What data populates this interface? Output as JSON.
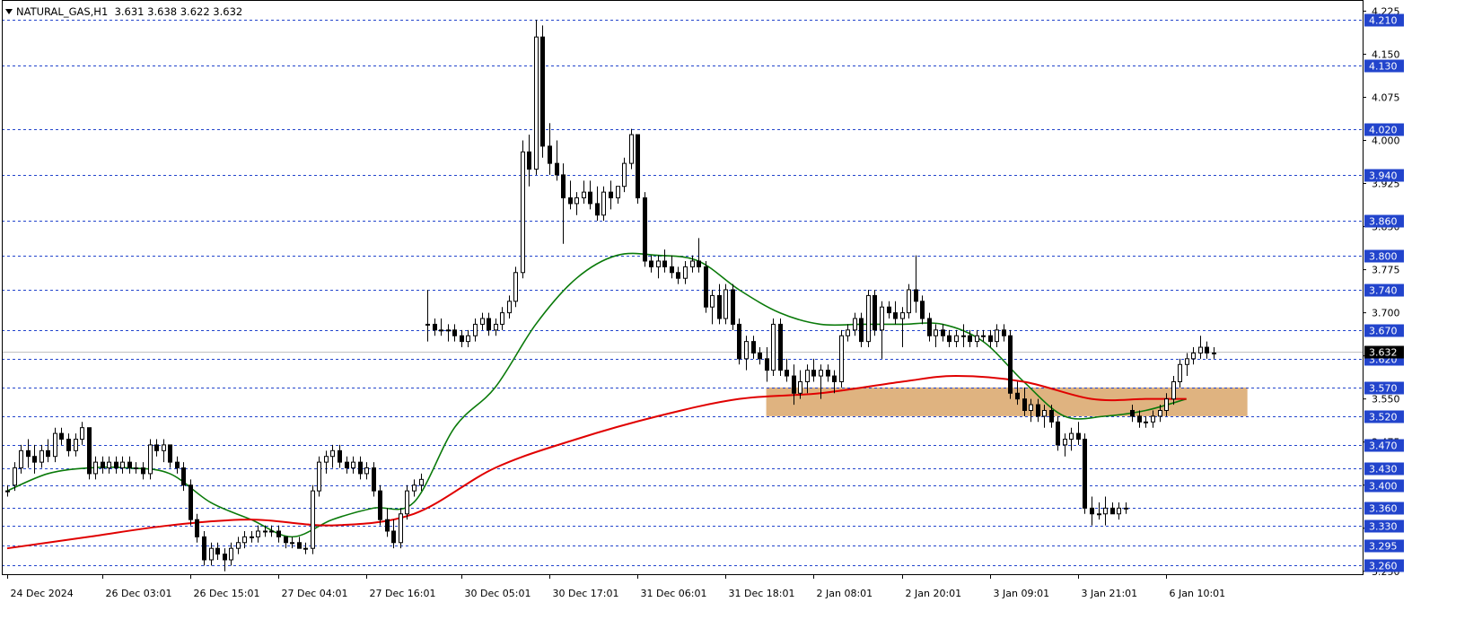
{
  "header": {
    "symbol": "NATURAL_GAS,H1",
    "ohlc": "3.631 3.638 3.622 3.632"
  },
  "colors": {
    "background": "#ffffff",
    "candle_outline": "#000000",
    "bull_fill": "#ffffff",
    "bear_fill": "#000000",
    "ma_fast": "#0a7a0a",
    "ma_slow": "#e00000",
    "level_line": "#2244cc",
    "level_label_bg": "#2244cc",
    "zone_fill": "#d9a66a",
    "price_line": "#c0c0c0",
    "current_label_bg": "#000000"
  },
  "chart_data": {
    "type": "candlestick",
    "title": "NATURAL_GAS,H1",
    "ylim": [
      3.245,
      4.235
    ],
    "y_ticks": [
      "4.225",
      "4.150",
      "4.075",
      "4.000",
      "3.925",
      "3.850",
      "3.775",
      "3.700",
      "3.625",
      "3.550",
      "3.475",
      "3.400",
      "3.325",
      "3.250"
    ],
    "x_ticks": [
      {
        "index": 0,
        "label": "24 Dec 2024"
      },
      {
        "index": 14,
        "label": "26 Dec 03:01"
      },
      {
        "index": 27,
        "label": "26 Dec 15:01"
      },
      {
        "index": 40,
        "label": "27 Dec 04:01"
      },
      {
        "index": 53,
        "label": "27 Dec 16:01"
      },
      {
        "index": 67,
        "label": "30 Dec 05:01"
      },
      {
        "index": 80,
        "label": "30 Dec 17:01"
      },
      {
        "index": 93,
        "label": "31 Dec 06:01"
      },
      {
        "index": 106,
        "label": "31 Dec 18:01"
      },
      {
        "index": 119,
        "label": "2 Jan 08:01"
      },
      {
        "index": 132,
        "label": "2 Jan 20:01"
      },
      {
        "index": 145,
        "label": "3 Jan 09:01"
      },
      {
        "index": 158,
        "label": "3 Jan 21:01"
      },
      {
        "index": 171,
        "label": "6 Jan 10:01"
      }
    ],
    "horizontal_levels": [
      "4.210",
      "4.130",
      "4.020",
      "3.940",
      "3.860",
      "3.800",
      "3.740",
      "3.670",
      "3.620",
      "3.570",
      "3.520",
      "3.470",
      "3.430",
      "3.400",
      "3.360",
      "3.330",
      "3.295",
      "3.260"
    ],
    "current_price": "3.632",
    "zone": {
      "start_index": 112,
      "end_index": 183,
      "low": 3.52,
      "high": 3.57
    },
    "candles": [
      [
        3.39,
        3.4,
        3.38,
        3.39
      ],
      [
        3.4,
        3.44,
        3.39,
        3.43
      ],
      [
        3.43,
        3.47,
        3.42,
        3.46
      ],
      [
        3.46,
        3.48,
        3.43,
        3.45
      ],
      [
        3.45,
        3.47,
        3.42,
        3.44
      ],
      [
        3.44,
        3.47,
        3.43,
        3.46
      ],
      [
        3.46,
        3.48,
        3.44,
        3.45
      ],
      [
        3.45,
        3.5,
        3.44,
        3.49
      ],
      [
        3.49,
        3.5,
        3.47,
        3.48
      ],
      [
        3.48,
        3.49,
        3.45,
        3.46
      ],
      [
        3.46,
        3.49,
        3.45,
        3.48
      ],
      [
        3.48,
        3.51,
        3.47,
        3.5
      ],
      [
        3.5,
        3.5,
        3.41,
        3.42
      ],
      [
        3.42,
        3.45,
        3.41,
        3.44
      ],
      [
        3.44,
        3.45,
        3.42,
        3.43
      ],
      [
        3.43,
        3.45,
        3.42,
        3.44
      ],
      [
        3.44,
        3.45,
        3.42,
        3.43
      ],
      [
        3.43,
        3.45,
        3.42,
        3.44
      ],
      [
        3.44,
        3.45,
        3.42,
        3.43
      ],
      [
        3.43,
        3.44,
        3.42,
        3.43
      ],
      [
        3.43,
        3.44,
        3.41,
        3.42
      ],
      [
        3.42,
        3.48,
        3.41,
        3.47
      ],
      [
        3.47,
        3.48,
        3.45,
        3.46
      ],
      [
        3.46,
        3.48,
        3.44,
        3.47
      ],
      [
        3.47,
        3.47,
        3.43,
        3.44
      ],
      [
        3.44,
        3.45,
        3.42,
        3.43
      ],
      [
        3.43,
        3.44,
        3.39,
        3.4
      ],
      [
        3.4,
        3.41,
        3.33,
        3.34
      ],
      [
        3.34,
        3.35,
        3.3,
        3.31
      ],
      [
        3.31,
        3.32,
        3.26,
        3.27
      ],
      [
        3.27,
        3.3,
        3.26,
        3.29
      ],
      [
        3.29,
        3.3,
        3.27,
        3.28
      ],
      [
        3.28,
        3.29,
        3.25,
        3.27
      ],
      [
        3.27,
        3.3,
        3.26,
        3.29
      ],
      [
        3.29,
        3.31,
        3.28,
        3.3
      ],
      [
        3.3,
        3.32,
        3.29,
        3.31
      ],
      [
        3.31,
        3.32,
        3.3,
        3.31
      ],
      [
        3.31,
        3.33,
        3.3,
        3.32
      ],
      [
        3.32,
        3.33,
        3.31,
        3.32
      ],
      [
        3.32,
        3.33,
        3.31,
        3.32
      ],
      [
        3.32,
        3.33,
        3.3,
        3.31
      ],
      [
        3.31,
        3.31,
        3.29,
        3.3
      ],
      [
        3.3,
        3.31,
        3.29,
        3.3
      ],
      [
        3.3,
        3.31,
        3.29,
        3.29
      ],
      [
        3.29,
        3.3,
        3.28,
        3.29
      ],
      [
        3.29,
        3.4,
        3.28,
        3.39
      ],
      [
        3.39,
        3.45,
        3.38,
        3.44
      ],
      [
        3.44,
        3.46,
        3.42,
        3.45
      ],
      [
        3.45,
        3.47,
        3.43,
        3.46
      ],
      [
        3.46,
        3.47,
        3.43,
        3.44
      ],
      [
        3.44,
        3.45,
        3.42,
        3.43
      ],
      [
        3.43,
        3.45,
        3.42,
        3.44
      ],
      [
        3.44,
        3.45,
        3.41,
        3.42
      ],
      [
        3.42,
        3.44,
        3.41,
        3.43
      ],
      [
        3.43,
        3.44,
        3.38,
        3.39
      ],
      [
        3.39,
        3.4,
        3.33,
        3.34
      ],
      [
        3.34,
        3.36,
        3.31,
        3.32
      ],
      [
        3.32,
        3.34,
        3.29,
        3.3
      ],
      [
        3.3,
        3.36,
        3.29,
        3.35
      ],
      [
        3.35,
        3.4,
        3.34,
        3.39
      ],
      [
        3.39,
        3.41,
        3.38,
        3.4
      ],
      [
        3.4,
        3.42,
        3.39,
        3.41
      ],
      [
        3.68,
        3.74,
        3.65,
        3.68
      ],
      [
        3.68,
        3.69,
        3.66,
        3.67
      ],
      [
        3.67,
        3.69,
        3.66,
        3.67
      ],
      [
        3.67,
        3.68,
        3.65,
        3.67
      ],
      [
        3.67,
        3.68,
        3.65,
        3.66
      ],
      [
        3.66,
        3.67,
        3.64,
        3.65
      ],
      [
        3.65,
        3.67,
        3.64,
        3.66
      ],
      [
        3.66,
        3.69,
        3.65,
        3.68
      ],
      [
        3.68,
        3.7,
        3.67,
        3.69
      ],
      [
        3.69,
        3.7,
        3.66,
        3.67
      ],
      [
        3.67,
        3.69,
        3.66,
        3.68
      ],
      [
        3.68,
        3.71,
        3.67,
        3.7
      ],
      [
        3.7,
        3.73,
        3.69,
        3.72
      ],
      [
        3.72,
        3.78,
        3.71,
        3.77
      ],
      [
        3.77,
        4.0,
        3.76,
        3.98
      ],
      [
        3.98,
        4.01,
        3.92,
        3.95
      ],
      [
        3.95,
        4.21,
        3.94,
        4.18
      ],
      [
        4.18,
        4.2,
        3.97,
        3.99
      ],
      [
        3.99,
        4.03,
        3.94,
        3.96
      ],
      [
        3.96,
        4.0,
        3.93,
        3.94
      ],
      [
        3.94,
        3.96,
        3.82,
        3.9
      ],
      [
        3.9,
        3.93,
        3.88,
        3.89
      ],
      [
        3.89,
        3.91,
        3.87,
        3.9
      ],
      [
        3.9,
        3.93,
        3.89,
        3.91
      ],
      [
        3.91,
        3.93,
        3.88,
        3.89
      ],
      [
        3.89,
        3.92,
        3.86,
        3.87
      ],
      [
        3.87,
        3.92,
        3.86,
        3.91
      ],
      [
        3.91,
        3.93,
        3.88,
        3.9
      ],
      [
        3.9,
        3.92,
        3.89,
        3.92
      ],
      [
        3.92,
        3.97,
        3.91,
        3.96
      ],
      [
        3.96,
        4.02,
        3.95,
        4.01
      ],
      [
        4.01,
        4.01,
        3.89,
        3.9
      ],
      [
        3.9,
        3.91,
        3.78,
        3.79
      ],
      [
        3.79,
        3.8,
        3.77,
        3.78
      ],
      [
        3.78,
        3.8,
        3.76,
        3.79
      ],
      [
        3.79,
        3.81,
        3.77,
        3.78
      ],
      [
        3.78,
        3.8,
        3.76,
        3.77
      ],
      [
        3.77,
        3.78,
        3.75,
        3.76
      ],
      [
        3.76,
        3.79,
        3.75,
        3.78
      ],
      [
        3.78,
        3.8,
        3.77,
        3.79
      ],
      [
        3.79,
        3.83,
        3.77,
        3.78
      ],
      [
        3.78,
        3.79,
        3.7,
        3.71
      ],
      [
        3.71,
        3.74,
        3.68,
        3.73
      ],
      [
        3.73,
        3.75,
        3.68,
        3.69
      ],
      [
        3.69,
        3.75,
        3.68,
        3.74
      ],
      [
        3.74,
        3.75,
        3.67,
        3.68
      ],
      [
        3.68,
        3.69,
        3.61,
        3.62
      ],
      [
        3.62,
        3.66,
        3.6,
        3.65
      ],
      [
        3.65,
        3.66,
        3.62,
        3.63
      ],
      [
        3.63,
        3.64,
        3.61,
        3.62
      ],
      [
        3.62,
        3.64,
        3.58,
        3.6
      ],
      [
        3.6,
        3.69,
        3.59,
        3.68
      ],
      [
        3.68,
        3.69,
        3.59,
        3.6
      ],
      [
        3.6,
        3.62,
        3.58,
        3.59
      ],
      [
        3.59,
        3.61,
        3.54,
        3.56
      ],
      [
        3.56,
        3.6,
        3.55,
        3.58
      ],
      [
        3.58,
        3.61,
        3.56,
        3.6
      ],
      [
        3.6,
        3.62,
        3.58,
        3.59
      ],
      [
        3.59,
        3.61,
        3.55,
        3.6
      ],
      [
        3.6,
        3.61,
        3.58,
        3.59
      ],
      [
        3.59,
        3.6,
        3.56,
        3.58
      ],
      [
        3.58,
        3.67,
        3.57,
        3.66
      ],
      [
        3.66,
        3.68,
        3.65,
        3.67
      ],
      [
        3.67,
        3.7,
        3.66,
        3.69
      ],
      [
        3.69,
        3.7,
        3.64,
        3.65
      ],
      [
        3.65,
        3.74,
        3.64,
        3.73
      ],
      [
        3.73,
        3.74,
        3.66,
        3.67
      ],
      [
        3.67,
        3.72,
        3.62,
        3.71
      ],
      [
        3.71,
        3.72,
        3.69,
        3.7
      ],
      [
        3.7,
        3.72,
        3.68,
        3.69
      ],
      [
        3.69,
        3.71,
        3.64,
        3.7
      ],
      [
        3.7,
        3.75,
        3.69,
        3.74
      ],
      [
        3.74,
        3.8,
        3.7,
        3.72
      ],
      [
        3.72,
        3.73,
        3.68,
        3.69
      ],
      [
        3.69,
        3.7,
        3.65,
        3.66
      ],
      [
        3.66,
        3.68,
        3.64,
        3.67
      ],
      [
        3.67,
        3.68,
        3.65,
        3.66
      ],
      [
        3.66,
        3.67,
        3.64,
        3.65
      ],
      [
        3.65,
        3.67,
        3.64,
        3.66
      ],
      [
        3.66,
        3.68,
        3.64,
        3.66
      ],
      [
        3.66,
        3.67,
        3.64,
        3.65
      ],
      [
        3.65,
        3.67,
        3.64,
        3.66
      ],
      [
        3.66,
        3.67,
        3.65,
        3.66
      ],
      [
        3.66,
        3.67,
        3.64,
        3.65
      ],
      [
        3.65,
        3.68,
        3.64,
        3.67
      ],
      [
        3.67,
        3.68,
        3.65,
        3.66
      ],
      [
        3.66,
        3.67,
        3.55,
        3.56
      ],
      [
        3.56,
        3.58,
        3.54,
        3.55
      ],
      [
        3.55,
        3.57,
        3.52,
        3.53
      ],
      [
        3.53,
        3.55,
        3.51,
        3.54
      ],
      [
        3.54,
        3.55,
        3.51,
        3.52
      ],
      [
        3.52,
        3.54,
        3.5,
        3.53
      ],
      [
        3.53,
        3.54,
        3.5,
        3.51
      ],
      [
        3.51,
        3.52,
        3.46,
        3.47
      ],
      [
        3.47,
        3.49,
        3.45,
        3.48
      ],
      [
        3.48,
        3.5,
        3.46,
        3.49
      ],
      [
        3.49,
        3.51,
        3.47,
        3.48
      ],
      [
        3.48,
        3.49,
        3.35,
        3.36
      ],
      [
        3.36,
        3.38,
        3.33,
        3.35
      ],
      [
        3.35,
        3.37,
        3.34,
        3.35
      ],
      [
        3.35,
        3.38,
        3.33,
        3.36
      ],
      [
        3.36,
        3.37,
        3.35,
        3.35
      ],
      [
        3.35,
        3.37,
        3.34,
        3.36
      ],
      [
        3.36,
        3.37,
        3.35,
        3.36
      ],
      [
        3.53,
        3.54,
        3.51,
        3.52
      ],
      [
        3.52,
        3.53,
        3.5,
        3.51
      ],
      [
        3.51,
        3.52,
        3.5,
        3.51
      ],
      [
        3.51,
        3.53,
        3.5,
        3.52
      ],
      [
        3.52,
        3.54,
        3.51,
        3.53
      ],
      [
        3.53,
        3.56,
        3.52,
        3.55
      ],
      [
        3.55,
        3.59,
        3.54,
        3.58
      ],
      [
        3.58,
        3.62,
        3.57,
        3.61
      ],
      [
        3.61,
        3.63,
        3.59,
        3.62
      ],
      [
        3.62,
        3.64,
        3.61,
        3.63
      ],
      [
        3.63,
        3.66,
        3.62,
        3.64
      ],
      [
        3.64,
        3.65,
        3.62,
        3.63
      ],
      [
        3.63,
        3.64,
        3.62,
        3.63
      ]
    ],
    "series": [
      {
        "name": "",
        "type": "ma",
        "values": [
          [
            0,
            3.39
          ],
          [
            6,
            3.42
          ],
          [
            12,
            3.43
          ],
          [
            18,
            3.43
          ],
          [
            24,
            3.42
          ],
          [
            30,
            3.37
          ],
          [
            36,
            3.34
          ],
          [
            42,
            3.31
          ],
          [
            48,
            3.34
          ],
          [
            54,
            3.36
          ],
          [
            60,
            3.37
          ],
          [
            66,
            3.5
          ],
          [
            72,
            3.57
          ],
          [
            78,
            3.68
          ],
          [
            84,
            3.76
          ],
          [
            90,
            3.8
          ],
          [
            96,
            3.8
          ],
          [
            102,
            3.79
          ],
          [
            108,
            3.74
          ],
          [
            114,
            3.7
          ],
          [
            120,
            3.68
          ],
          [
            126,
            3.68
          ],
          [
            132,
            3.68
          ],
          [
            138,
            3.68
          ],
          [
            144,
            3.65
          ],
          [
            150,
            3.58
          ],
          [
            156,
            3.52
          ],
          [
            162,
            3.52
          ],
          [
            168,
            3.53
          ],
          [
            174,
            3.55
          ]
        ]
      },
      {
        "name": "",
        "type": "ma",
        "values": [
          [
            0,
            3.29
          ],
          [
            12,
            3.31
          ],
          [
            24,
            3.33
          ],
          [
            36,
            3.34
          ],
          [
            48,
            3.33
          ],
          [
            60,
            3.35
          ],
          [
            72,
            3.43
          ],
          [
            84,
            3.48
          ],
          [
            96,
            3.52
          ],
          [
            108,
            3.55
          ],
          [
            120,
            3.56
          ],
          [
            132,
            3.58
          ],
          [
            140,
            3.59
          ],
          [
            150,
            3.58
          ],
          [
            160,
            3.55
          ],
          [
            168,
            3.55
          ],
          [
            174,
            3.55
          ]
        ]
      }
    ]
  }
}
